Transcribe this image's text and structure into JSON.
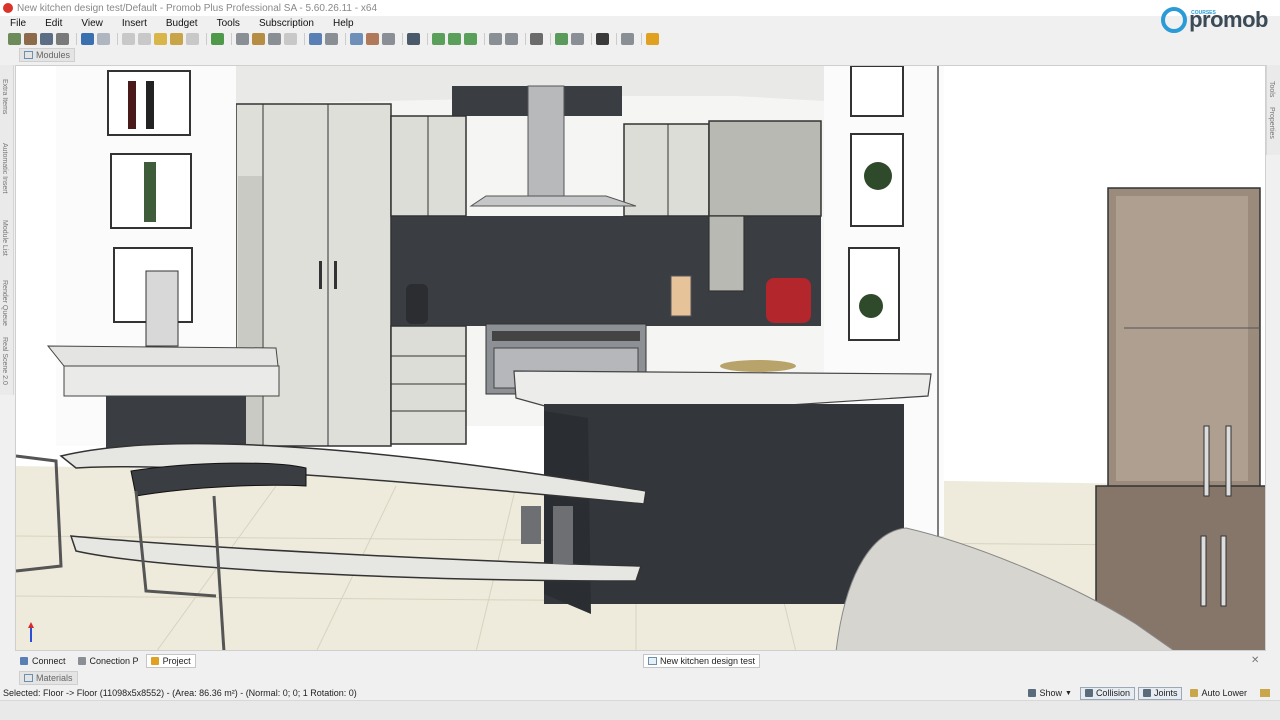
{
  "window": {
    "title": "New kitchen design test/Default - Promob Plus Professional SA - 5.60.26.11 - x64"
  },
  "logo": {
    "main": "promob",
    "sub": "COURSES"
  },
  "menu": [
    "File",
    "Edit",
    "View",
    "Insert",
    "Budget",
    "Tools",
    "Subscription",
    "Help"
  ],
  "toolbar_icons": [
    "new-icon",
    "open-icon",
    "save-icon",
    "print-icon",
    "undo-icon",
    "redo-icon",
    "cut-icon",
    "copy-icon",
    "paste-icon",
    "select-icon",
    "measure-icon",
    "render-icon",
    "view-icon",
    "camera-icon",
    "move-icon"
  ],
  "panels": {
    "modules": "Modules",
    "materials": "Materials"
  },
  "left_rail": [
    "Extra Items",
    "Automatic Insert",
    "Module List",
    "Render Queue",
    "Real Scene 2.0"
  ],
  "right_rail": [
    "Tools",
    "Properties"
  ],
  "bottom_tabs": [
    {
      "label": "Connect",
      "active": false
    },
    {
      "label": "Conection P",
      "active": false
    },
    {
      "label": "Project",
      "active": true
    }
  ],
  "document_tab": "New kitchen design test",
  "status": {
    "selected": "Selected: Floor -> Floor (11098x5x8552) - (Area: 86.36 m²) - (Normal: 0; 0; 1 Rotation: 0)",
    "show": "Show",
    "collision": "Collision",
    "joints": "Joints",
    "auto_lower": "Auto Lower"
  },
  "colors": {
    "accent": "#2a9bd6",
    "cabinet": "#dcdcd6",
    "dark_panel": "#33373c",
    "wood": "#8a7868",
    "counter": "#e2e2e0"
  }
}
